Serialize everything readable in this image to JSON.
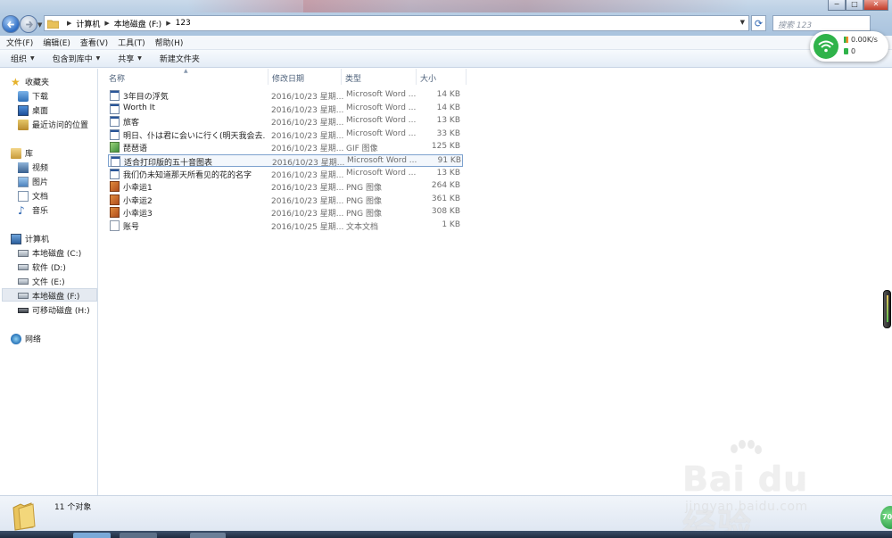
{
  "address": {
    "crumbs": [
      "计算机",
      "本地磁盘 (F:)",
      "123"
    ]
  },
  "search": {
    "placeholder": "搜索 123"
  },
  "window_controls": {
    "minimize": "−",
    "maximize": "□",
    "close": "✕"
  },
  "menubar": [
    "文件(F)",
    "编辑(E)",
    "查看(V)",
    "工具(T)",
    "帮助(H)"
  ],
  "commandbar": {
    "organize": "组织",
    "include_library": "包含到库中",
    "share": "共享",
    "new_folder": "新建文件夹"
  },
  "network_widget": {
    "speed": "0.00K/s",
    "count": "0"
  },
  "nav": {
    "favorites": {
      "label": "收藏夹",
      "items": [
        "下载",
        "桌面",
        "最近访问的位置"
      ]
    },
    "libraries": {
      "label": "库",
      "items": [
        "视频",
        "图片",
        "文档",
        "音乐"
      ]
    },
    "computer": {
      "label": "计算机",
      "items": [
        "本地磁盘 (C:)",
        "软件 (D:)",
        "文件 (E:)",
        "本地磁盘 (F:)",
        "可移动磁盘 (H:)"
      ]
    },
    "network": {
      "label": "网络"
    }
  },
  "columns": [
    "名称",
    "修改日期",
    "类型",
    "大小"
  ],
  "files": [
    {
      "name": "3年目の浮気",
      "date": "2016/10/23 星期...",
      "type": "Microsoft Word ...",
      "size": "14 KB",
      "icon": "word"
    },
    {
      "name": "Worth It",
      "date": "2016/10/23 星期...",
      "type": "Microsoft Word ...",
      "size": "14 KB",
      "icon": "word"
    },
    {
      "name": "旅客",
      "date": "2016/10/23 星期...",
      "type": "Microsoft Word ...",
      "size": "13 KB",
      "icon": "word"
    },
    {
      "name": "明日、仆は君に会いに行く(明天我会去...",
      "date": "2016/10/23 星期...",
      "type": "Microsoft Word ...",
      "size": "33 KB",
      "icon": "word"
    },
    {
      "name": "琵琶语",
      "date": "2016/10/23 星期...",
      "type": "GIF 图像",
      "size": "125 KB",
      "icon": "gif"
    },
    {
      "name": "适合打印版的五十音图表",
      "date": "2016/10/23 星期...",
      "type": "Microsoft Word ...",
      "size": "91 KB",
      "icon": "word"
    },
    {
      "name": "我们仍未知道那天所看见的花的名字",
      "date": "2016/10/23 星期...",
      "type": "Microsoft Word ...",
      "size": "13 KB",
      "icon": "word"
    },
    {
      "name": "小幸运1",
      "date": "2016/10/23 星期...",
      "type": "PNG 图像",
      "size": "264 KB",
      "icon": "png"
    },
    {
      "name": "小幸运2",
      "date": "2016/10/23 星期...",
      "type": "PNG 图像",
      "size": "361 KB",
      "icon": "png"
    },
    {
      "name": "小幸运3",
      "date": "2016/10/23 星期...",
      "type": "PNG 图像",
      "size": "308 KB",
      "icon": "png"
    },
    {
      "name": "账号",
      "date": "2016/10/25 星期...",
      "type": "文本文档",
      "size": "1 KB",
      "icon": "txt"
    }
  ],
  "status": {
    "count": "11 个对象"
  },
  "watermark": {
    "brand": "Bai du 经验",
    "url": "jingyan.baidu.com"
  },
  "corner_badge": "70",
  "colors": {
    "accent": "#2e6dc4",
    "wifi": "#2fb34a",
    "selection": "#e5eaf1"
  }
}
